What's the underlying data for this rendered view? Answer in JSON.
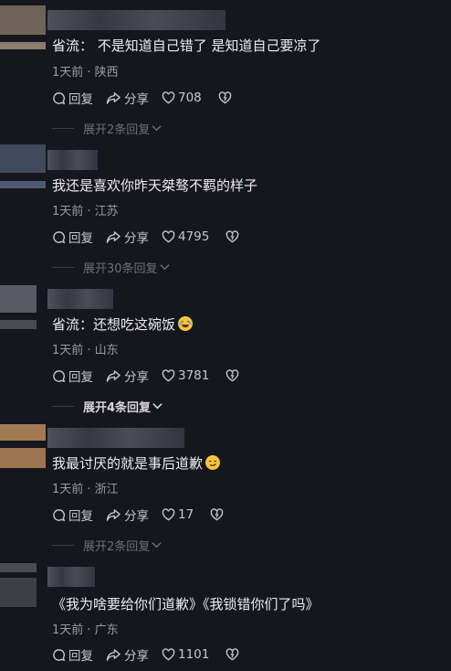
{
  "comments": [
    {
      "text": "省流：  不是知道自己错了 是知道自己要凉了",
      "meta": "1天前 · 陕西",
      "reply_label": "回复",
      "share_label": "分享",
      "likes": "708",
      "expand": "展开2条回复"
    },
    {
      "text": "我还是喜欢你昨天桀骜不羁的样子",
      "meta": "1天前 · 江苏",
      "reply_label": "回复",
      "share_label": "分享",
      "likes": "4795",
      "expand": "展开30条回复"
    },
    {
      "text": "省流：还想吃这碗饭",
      "meta": "1天前 · 山东",
      "reply_label": "回复",
      "share_label": "分享",
      "likes": "3781",
      "expand": "展开4条回复",
      "emoji": "laughing-tears-emoji"
    },
    {
      "text": "我最讨厌的就是事后道歉",
      "meta": "1天前 · 浙江",
      "reply_label": "回复",
      "share_label": "分享",
      "likes": "17",
      "expand": "展开2条回复",
      "emoji": "smirk-emoji"
    },
    {
      "text": "《我为啥要给你们道歉》《我锁错你们了吗》",
      "meta": "1天前 · 广东",
      "reply_label": "回复",
      "share_label": "分享",
      "likes": "1101"
    }
  ],
  "colors": {
    "background": "#16161e",
    "text": "#ececf0",
    "meta": "#9a9aa3",
    "expand_muted": "#6f6f78",
    "expand_active": "#d4d4d9"
  },
  "icons": [
    "reply-icon",
    "share-icon",
    "heart-icon",
    "dislike-heart-icon",
    "chevron-down-icon"
  ]
}
